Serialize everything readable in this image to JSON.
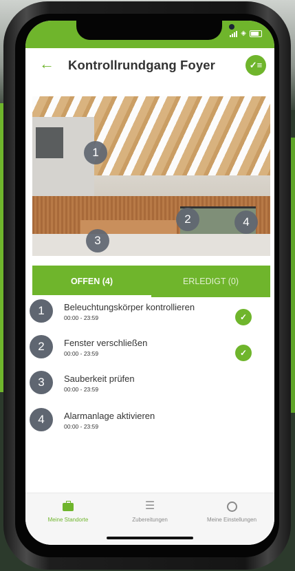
{
  "header": {
    "title": "Kontrollrundgang Foyer"
  },
  "photo": {
    "markers": [
      "1",
      "2",
      "3",
      "4"
    ]
  },
  "tabs": [
    {
      "label": "OFFEN (4)",
      "active": true
    },
    {
      "label": "ERLEDIGT (0)",
      "active": false
    }
  ],
  "tasks": [
    {
      "num": "1",
      "title": "Beleuchtungskörper kontrollieren",
      "time": "00:00 - 23:59",
      "checked": true
    },
    {
      "num": "2",
      "title": "Fenster verschließen",
      "time": "00:00 - 23:59",
      "checked": true
    },
    {
      "num": "3",
      "title": "Sauberkeit prüfen",
      "time": "00:00 - 23:59",
      "checked": false
    },
    {
      "num": "4",
      "title": "Alarmanlage aktivieren",
      "time": "00:00 - 23:59",
      "checked": false
    }
  ],
  "bottom_nav": [
    {
      "label": "Meine Standorte",
      "icon": "briefcase-icon",
      "active": true
    },
    {
      "label": "Zubereitungen",
      "icon": "checklist-icon",
      "active": false
    },
    {
      "label": "Meine Einstellungen",
      "icon": "person-icon",
      "active": false
    }
  ],
  "colors": {
    "accent": "#6fb52c",
    "marker": "#5f6671"
  }
}
